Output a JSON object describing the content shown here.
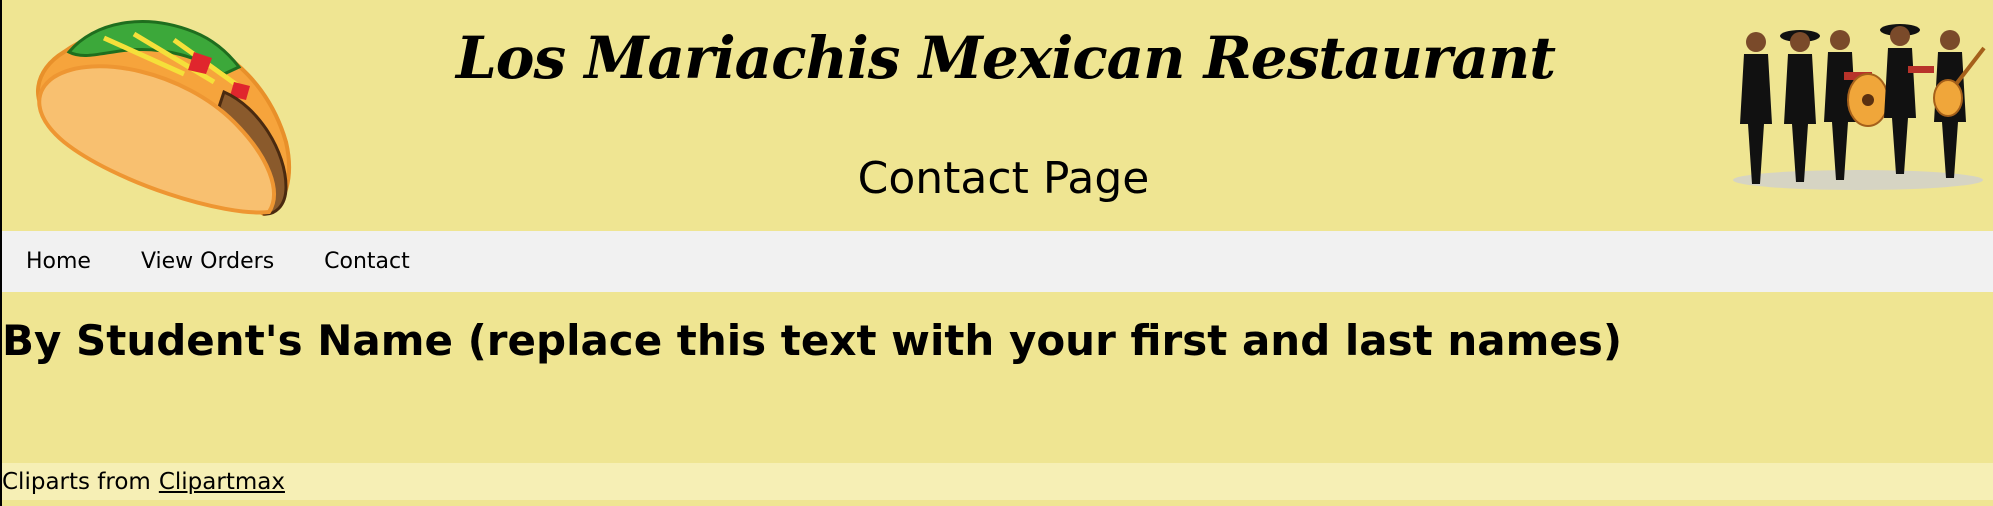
{
  "header": {
    "site_title": "Los Mariachis Mexican Restaurant",
    "page_title": "Contact Page",
    "logo_left": "taco-clipart",
    "logo_right": "mariachi-band-clipart"
  },
  "nav": {
    "items": [
      {
        "label": "Home"
      },
      {
        "label": "View Orders"
      },
      {
        "label": "Contact"
      }
    ]
  },
  "main": {
    "byline": "By Student's Name (replace this text with your first and last names)"
  },
  "footer": {
    "credit_prefix": "Cliparts from",
    "credit_link": "Clipartmax"
  },
  "colors": {
    "page_background": "#efe592",
    "nav_background": "#f1f1f1",
    "footer_background": "#f6efb5"
  }
}
